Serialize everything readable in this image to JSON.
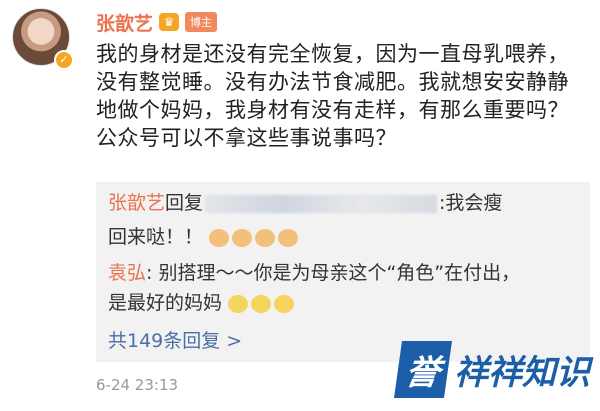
{
  "post": {
    "username": "张歆艺",
    "role_badge": "博主",
    "crown_icon": "crown-icon",
    "text": "我的身材是还没有完全恢复，因为一直母乳喂养，没有整觉睡。没有办法节食减肥。我就想安安静静地做个妈妈，我身材有没有走样，有那么重要吗？公众号可以不拿这些事说事吗？",
    "timestamp": "6-24 23:13"
  },
  "replies": {
    "items": [
      {
        "name": "张歆艺",
        "prefix": "回复",
        "suffix": ":我会瘦",
        "continuation": "回来哒！！",
        "emoji_icon": "flexed-biceps-emoji",
        "emoji_count": 4
      },
      {
        "name": "袁弘",
        "text": ": 别搭理～～你是为母亲这个“角色”在付出，",
        "continuation": "是最好的妈妈",
        "emoji_icon": "hugging-emoji",
        "emoji_count": 3
      }
    ],
    "more_label": "共149条回复 >"
  },
  "watermark": {
    "mark": "誉",
    "text": "祥祥知识"
  },
  "colors": {
    "username": "#eb7350",
    "link": "#4a6fa5",
    "reply_bg": "#f2f2f2",
    "logo": "#1c5fa8"
  }
}
